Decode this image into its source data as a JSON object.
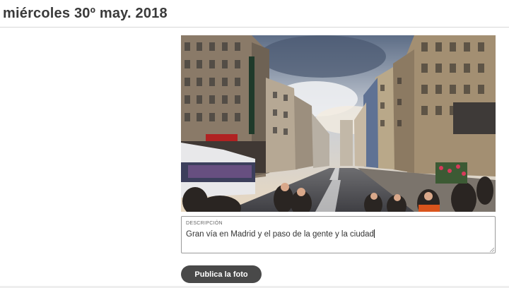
{
  "header": {
    "date_title": "miércoles 30º may. 2018"
  },
  "photo": {
    "subject": "street-photo"
  },
  "description": {
    "label": "DESCRIPCIÓN",
    "value": "Gran vía en Madrid y el paso de la gente y la ciudad"
  },
  "actions": {
    "publish_label": "Publica la foto"
  },
  "colors": {
    "button_bg": "#494949",
    "button_text": "#ffffff",
    "title_text": "#3a3a3a"
  }
}
